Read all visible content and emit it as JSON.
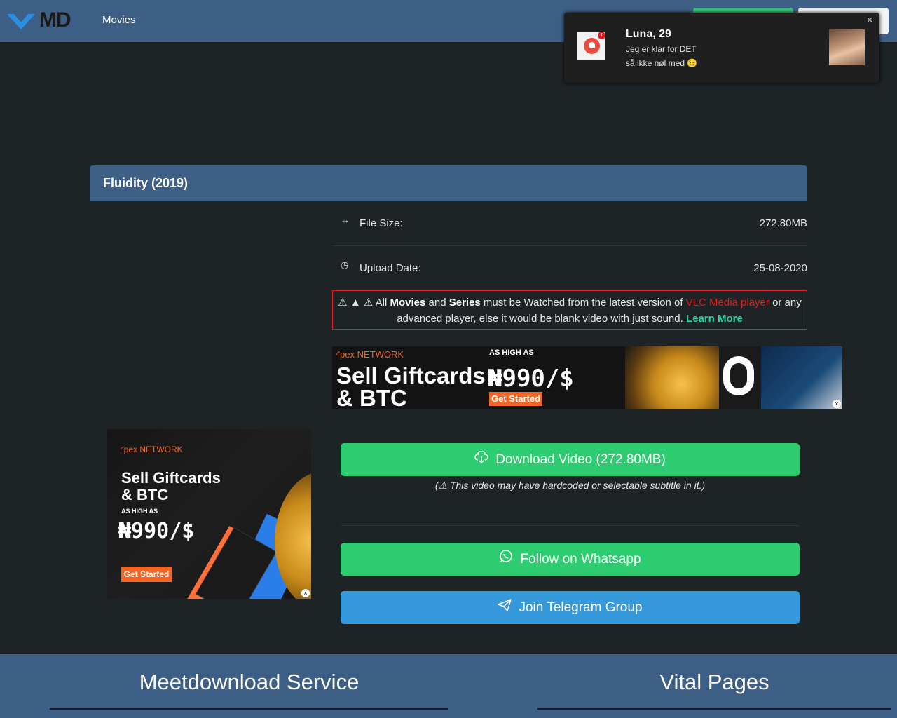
{
  "nav": {
    "logo_text": "MD",
    "links": [
      "Movies"
    ]
  },
  "notification": {
    "name": "Luna, 29",
    "line1": "Jeg er klar for DET",
    "line2": "så ikke nøl med 😉",
    "badge": "1",
    "close": "×"
  },
  "movie": {
    "title": "Fluidity (2019)",
    "file_size_label": "File Size:",
    "file_size": "272.80MB",
    "upload_date_label": "Upload Date:",
    "upload_date": "25-08-2020"
  },
  "warning": {
    "icons": "⚠ ▲ ⚠",
    "t1": "All ",
    "b1": "Movies",
    "t2": " and ",
    "b2": "Series",
    "t3": " must be Watched from the latest version of ",
    "red": "VLC Media player",
    "t4": " or any advanced player, else it would be blank video with just sound. ",
    "link": "Learn More"
  },
  "ads": {
    "brand": "pex",
    "brand_suffix": "NETWORK",
    "headline_line1": "Sell Giftcards",
    "headline_line2": "& BTC",
    "as_high_as": "AS HIGH AS",
    "price": "₦990/$",
    "cta": "Get Started"
  },
  "actions": {
    "download": "Download Video (272.80MB)",
    "subtitle_note": "(⚠ This video may have hardcoded or selectable subtitle in it.)",
    "whatsapp": "Follow on Whatsapp",
    "telegram": "Join Telegram Group"
  },
  "footer": {
    "col1": "Meetdownload Service",
    "col2": "Vital Pages"
  },
  "colors": {
    "navbar": "#3d5e85",
    "background": "#1e2326",
    "green": "#2ecc71",
    "blue": "#3598db",
    "warning_border": "#e41b1b",
    "link_teal": "#2ed1a1"
  }
}
